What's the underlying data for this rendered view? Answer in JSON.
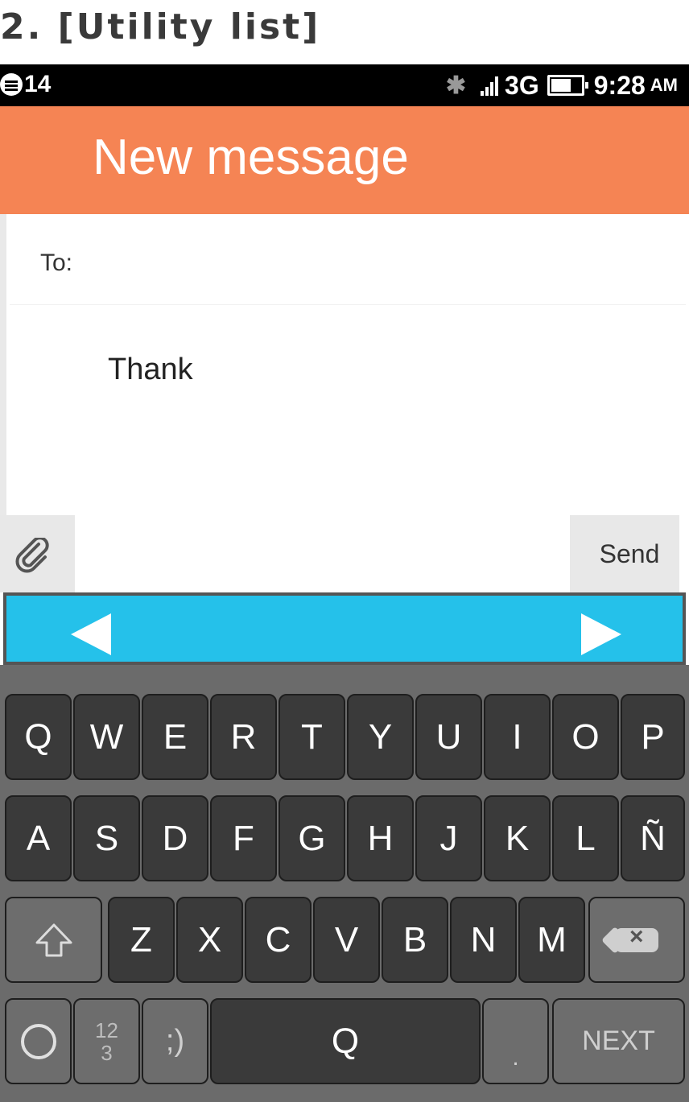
{
  "caption": "2. [Utility list]",
  "status_bar": {
    "notification_count": "14",
    "network_type": "3G",
    "time": "9:28",
    "ampm": "AM"
  },
  "header": {
    "title": "New message"
  },
  "compose": {
    "to_label": "To:",
    "message_text": "Thank",
    "send_label": "Send"
  },
  "keyboard": {
    "row1": [
      "Q",
      "W",
      "E",
      "R",
      "T",
      "Y",
      "U",
      "I",
      "O",
      "P"
    ],
    "row2": [
      "A",
      "S",
      "D",
      "F",
      "G",
      "H",
      "J",
      "K",
      "L",
      "Ñ"
    ],
    "row3": [
      "Z",
      "X",
      "C",
      "V",
      "B",
      "N",
      "M"
    ],
    "symbol_top": "12",
    "symbol_bottom": "3",
    "smiley": ";)",
    "space_label": "Q",
    "period": ".",
    "next_label": "NEXT"
  },
  "colors": {
    "header": "#f58454",
    "suggestion_bar": "#25c1ea"
  }
}
